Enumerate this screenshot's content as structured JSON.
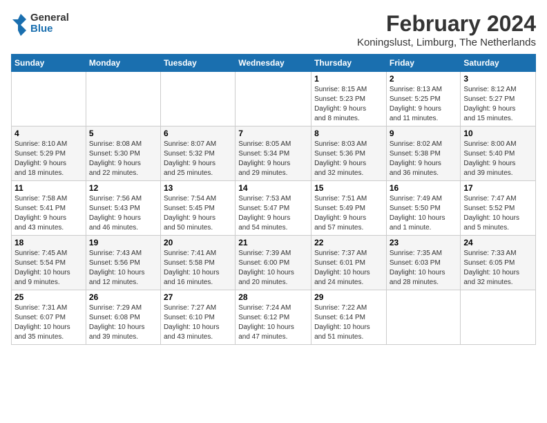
{
  "logo": {
    "line1": "General",
    "line2": "Blue"
  },
  "title": "February 2024",
  "subtitle": "Koningslust, Limburg, The Netherlands",
  "weekdays": [
    "Sunday",
    "Monday",
    "Tuesday",
    "Wednesday",
    "Thursday",
    "Friday",
    "Saturday"
  ],
  "weeks": [
    [
      {
        "day": "",
        "info": ""
      },
      {
        "day": "",
        "info": ""
      },
      {
        "day": "",
        "info": ""
      },
      {
        "day": "",
        "info": ""
      },
      {
        "day": "1",
        "info": "Sunrise: 8:15 AM\nSunset: 5:23 PM\nDaylight: 9 hours\nand 8 minutes."
      },
      {
        "day": "2",
        "info": "Sunrise: 8:13 AM\nSunset: 5:25 PM\nDaylight: 9 hours\nand 11 minutes."
      },
      {
        "day": "3",
        "info": "Sunrise: 8:12 AM\nSunset: 5:27 PM\nDaylight: 9 hours\nand 15 minutes."
      }
    ],
    [
      {
        "day": "4",
        "info": "Sunrise: 8:10 AM\nSunset: 5:29 PM\nDaylight: 9 hours\nand 18 minutes."
      },
      {
        "day": "5",
        "info": "Sunrise: 8:08 AM\nSunset: 5:30 PM\nDaylight: 9 hours\nand 22 minutes."
      },
      {
        "day": "6",
        "info": "Sunrise: 8:07 AM\nSunset: 5:32 PM\nDaylight: 9 hours\nand 25 minutes."
      },
      {
        "day": "7",
        "info": "Sunrise: 8:05 AM\nSunset: 5:34 PM\nDaylight: 9 hours\nand 29 minutes."
      },
      {
        "day": "8",
        "info": "Sunrise: 8:03 AM\nSunset: 5:36 PM\nDaylight: 9 hours\nand 32 minutes."
      },
      {
        "day": "9",
        "info": "Sunrise: 8:02 AM\nSunset: 5:38 PM\nDaylight: 9 hours\nand 36 minutes."
      },
      {
        "day": "10",
        "info": "Sunrise: 8:00 AM\nSunset: 5:40 PM\nDaylight: 9 hours\nand 39 minutes."
      }
    ],
    [
      {
        "day": "11",
        "info": "Sunrise: 7:58 AM\nSunset: 5:41 PM\nDaylight: 9 hours\nand 43 minutes."
      },
      {
        "day": "12",
        "info": "Sunrise: 7:56 AM\nSunset: 5:43 PM\nDaylight: 9 hours\nand 46 minutes."
      },
      {
        "day": "13",
        "info": "Sunrise: 7:54 AM\nSunset: 5:45 PM\nDaylight: 9 hours\nand 50 minutes."
      },
      {
        "day": "14",
        "info": "Sunrise: 7:53 AM\nSunset: 5:47 PM\nDaylight: 9 hours\nand 54 minutes."
      },
      {
        "day": "15",
        "info": "Sunrise: 7:51 AM\nSunset: 5:49 PM\nDaylight: 9 hours\nand 57 minutes."
      },
      {
        "day": "16",
        "info": "Sunrise: 7:49 AM\nSunset: 5:50 PM\nDaylight: 10 hours\nand 1 minute."
      },
      {
        "day": "17",
        "info": "Sunrise: 7:47 AM\nSunset: 5:52 PM\nDaylight: 10 hours\nand 5 minutes."
      }
    ],
    [
      {
        "day": "18",
        "info": "Sunrise: 7:45 AM\nSunset: 5:54 PM\nDaylight: 10 hours\nand 9 minutes."
      },
      {
        "day": "19",
        "info": "Sunrise: 7:43 AM\nSunset: 5:56 PM\nDaylight: 10 hours\nand 12 minutes."
      },
      {
        "day": "20",
        "info": "Sunrise: 7:41 AM\nSunset: 5:58 PM\nDaylight: 10 hours\nand 16 minutes."
      },
      {
        "day": "21",
        "info": "Sunrise: 7:39 AM\nSunset: 6:00 PM\nDaylight: 10 hours\nand 20 minutes."
      },
      {
        "day": "22",
        "info": "Sunrise: 7:37 AM\nSunset: 6:01 PM\nDaylight: 10 hours\nand 24 minutes."
      },
      {
        "day": "23",
        "info": "Sunrise: 7:35 AM\nSunset: 6:03 PM\nDaylight: 10 hours\nand 28 minutes."
      },
      {
        "day": "24",
        "info": "Sunrise: 7:33 AM\nSunset: 6:05 PM\nDaylight: 10 hours\nand 32 minutes."
      }
    ],
    [
      {
        "day": "25",
        "info": "Sunrise: 7:31 AM\nSunset: 6:07 PM\nDaylight: 10 hours\nand 35 minutes."
      },
      {
        "day": "26",
        "info": "Sunrise: 7:29 AM\nSunset: 6:08 PM\nDaylight: 10 hours\nand 39 minutes."
      },
      {
        "day": "27",
        "info": "Sunrise: 7:27 AM\nSunset: 6:10 PM\nDaylight: 10 hours\nand 43 minutes."
      },
      {
        "day": "28",
        "info": "Sunrise: 7:24 AM\nSunset: 6:12 PM\nDaylight: 10 hours\nand 47 minutes."
      },
      {
        "day": "29",
        "info": "Sunrise: 7:22 AM\nSunset: 6:14 PM\nDaylight: 10 hours\nand 51 minutes."
      },
      {
        "day": "",
        "info": ""
      },
      {
        "day": "",
        "info": ""
      }
    ]
  ]
}
